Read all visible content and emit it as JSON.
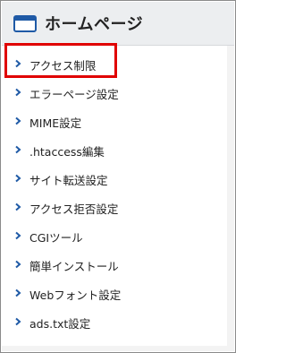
{
  "header": {
    "title": "ホームページ",
    "icon": "window-icon"
  },
  "menu": {
    "items": [
      {
        "label": "アクセス制限",
        "highlighted": true
      },
      {
        "label": "エラーページ設定"
      },
      {
        "label": "MIME設定"
      },
      {
        "label": ".htaccess編集"
      },
      {
        "label": "サイト転送設定"
      },
      {
        "label": "アクセス拒否設定"
      },
      {
        "label": "CGIツール"
      },
      {
        "label": "簡単インストール"
      },
      {
        "label": "Webフォント設定"
      },
      {
        "label": "ads.txt設定"
      }
    ]
  },
  "colors": {
    "accent": "#1f5aa6",
    "highlight": "#e00000",
    "header_bg": "#eceef0"
  }
}
